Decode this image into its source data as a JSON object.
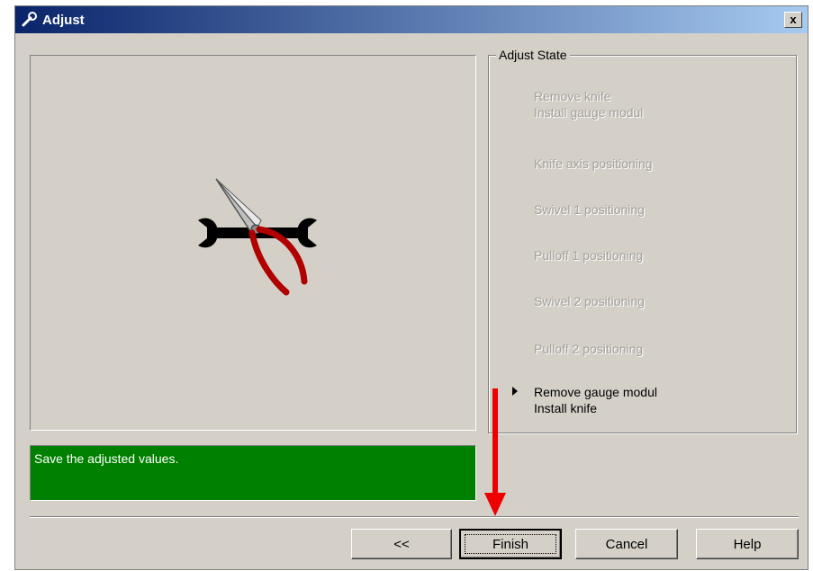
{
  "window": {
    "title": "Adjust",
    "close_label": "x",
    "icon": "wrench-icon"
  },
  "image_panel": {
    "icon": "wrench-pliers-icon"
  },
  "adjust_state": {
    "title": "Adjust State",
    "steps": [
      {
        "label": "Remove knife\nInstall gauge modul",
        "state": "done"
      },
      {
        "label": "Knife axis positioning",
        "state": "done"
      },
      {
        "label": "Swivel 1 positioning",
        "state": "done"
      },
      {
        "label": "Pulloff 1 positioning",
        "state": "done"
      },
      {
        "label": "Swivel 2 positioning",
        "state": "done"
      },
      {
        "label": "Pulloff 2 positioning",
        "state": "done"
      },
      {
        "label": "Remove gauge modul\nInstall knife",
        "state": "current"
      }
    ]
  },
  "status": {
    "message": "Save the adjusted values.",
    "color": "#008000"
  },
  "buttons": {
    "back": "<<",
    "finish": "Finish",
    "cancel": "Cancel",
    "help": "Help"
  },
  "annotation": {
    "arrow_color": "#ee0000"
  }
}
